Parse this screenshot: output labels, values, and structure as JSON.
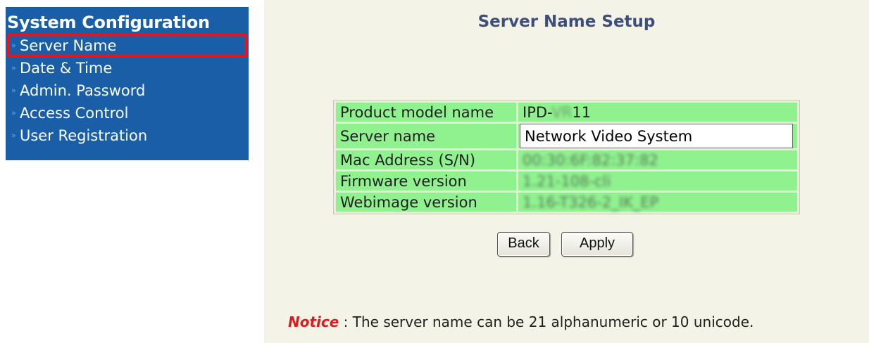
{
  "sidebar": {
    "title": "System Configuration",
    "arrow_glyph": "»",
    "items": [
      {
        "label": "Server Name",
        "active": true
      },
      {
        "label": "Date & Time",
        "active": false
      },
      {
        "label": "Admin. Password",
        "active": false
      },
      {
        "label": "Access Control",
        "active": false
      },
      {
        "label": "User Registration",
        "active": false
      }
    ]
  },
  "main": {
    "title": "Server Name Setup",
    "rows": [
      {
        "label": "Product model name",
        "value_prefix": "IPD-",
        "value_hidden": "VR",
        "value_suffix": "11"
      },
      {
        "label": "Server name",
        "input_value": "Network Video System"
      },
      {
        "label": "Mac Address (S/N)",
        "value": "00:30:6F:82:37:82",
        "blurred": true
      },
      {
        "label": "Firmware version",
        "value": "1.21-108-cli",
        "blurred": true
      },
      {
        "label": "Webimage version",
        "value": "1.16-T326-2_IK_EP",
        "blurred": true
      }
    ],
    "buttons": {
      "back": "Back",
      "apply": "Apply"
    },
    "notice": {
      "label": "Notice",
      "text": " : The server name can be 21 alphanumeric or 10 unicode."
    }
  },
  "colors": {
    "sidebar_bg": "#1a5ea8",
    "active_border": "#e8141a",
    "panel_bg": "#f4f3e7",
    "row_bg": "#8ff28f",
    "title_color": "#3e4f7d",
    "notice_label": "#d81d1d"
  }
}
